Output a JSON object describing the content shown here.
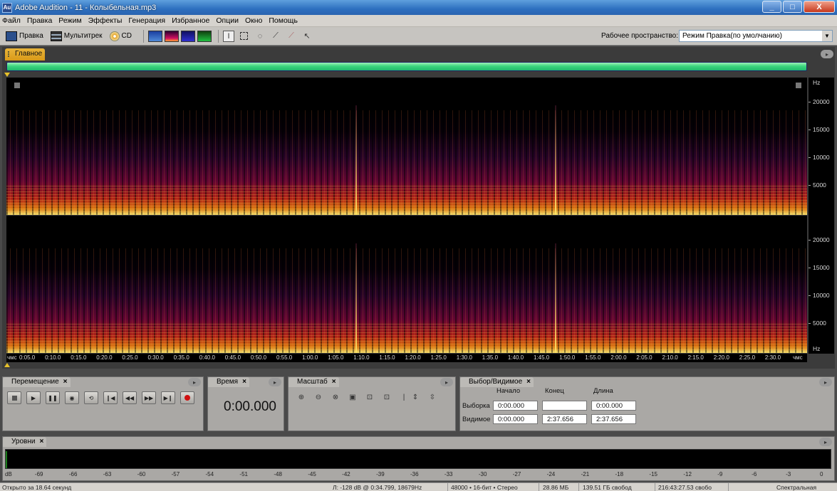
{
  "window": {
    "title": "Adobe Audition - 11 - Колыбельная.mp3",
    "app_icon": "Au",
    "buttons": {
      "minimize": "_",
      "maximize": "□",
      "close": "X"
    }
  },
  "menu": [
    "Файл",
    "Правка",
    "Режим",
    "Эффекты",
    "Генерация",
    "Избранное",
    "Опции",
    "Окно",
    "Помощь"
  ],
  "toolbar": {
    "edit_label": "Правка",
    "multitrack_label": "Мультитрек",
    "cd_label": "CD",
    "workspace_label": "Рабочее пространство:",
    "workspace_value": "Режим Правка(по умолчанию)"
  },
  "main_tab": {
    "label": "Главное"
  },
  "hz_axis": {
    "unit": "Hz",
    "ticks": [
      "20000",
      "15000",
      "10000",
      "5000"
    ],
    "bottom_unit": "Hz"
  },
  "time_axis": {
    "start_unit": "чмс",
    "end_unit": "чмс",
    "ticks": [
      "0:05.0",
      "0:10.0",
      "0:15.0",
      "0:20.0",
      "0:25.0",
      "0:30.0",
      "0:35.0",
      "0:40.0",
      "0:45.0",
      "0:50.0",
      "0:55.0",
      "1:00.0",
      "1:05.0",
      "1:10.0",
      "1:15.0",
      "1:20.0",
      "1:25.0",
      "1:30.0",
      "1:35.0",
      "1:40.0",
      "1:45.0",
      "1:50.0",
      "1:55.0",
      "2:00.0",
      "2:05.0",
      "2:10.0",
      "2:15.0",
      "2:20.0",
      "2:25.0",
      "2:30.0"
    ]
  },
  "transport": {
    "tab_label": "Перемещение",
    "buttons": [
      "stop",
      "play",
      "pause",
      "play-from-cursor",
      "loop",
      "go-to-start",
      "rewind",
      "fast-forward",
      "go-to-end",
      "record"
    ]
  },
  "time_panel": {
    "tab_label": "Время",
    "value": "0:00.000"
  },
  "zoom_panel": {
    "tab_label": "Масштаб"
  },
  "selection_panel": {
    "tab_label": "Выбор/Видимое",
    "col_start": "Начало",
    "col_end": "Конец",
    "col_length": "Длина",
    "selection": {
      "label": "Выборка",
      "start": "0:00.000",
      "end": "",
      "length": "0:00.000"
    },
    "view": {
      "label": "Видимое",
      "start": "0:00.000",
      "end": "2:37.656",
      "length": "2:37.656"
    }
  },
  "levels": {
    "tab_label": "Уровни",
    "ticks": [
      "dB",
      "-69",
      "-66",
      "-63",
      "-60",
      "-57",
      "-54",
      "-51",
      "-48",
      "-45",
      "-42",
      "-39",
      "-36",
      "-33",
      "-30",
      "-27",
      "-24",
      "-21",
      "-18",
      "-15",
      "-12",
      "-9",
      "-6",
      "-3",
      "0"
    ]
  },
  "status": {
    "opened": "Открыто за 18.64 секунд",
    "cursor": "Л: -128 dB @ 0:34.799, 18679Hz",
    "format": "48000 • 16-бит • Стерео",
    "size": "28.86 МБ",
    "free": "139.51 ГБ свобод",
    "free_time": "216:43:27.53 свобо",
    "view_mode": "Спектральная"
  }
}
